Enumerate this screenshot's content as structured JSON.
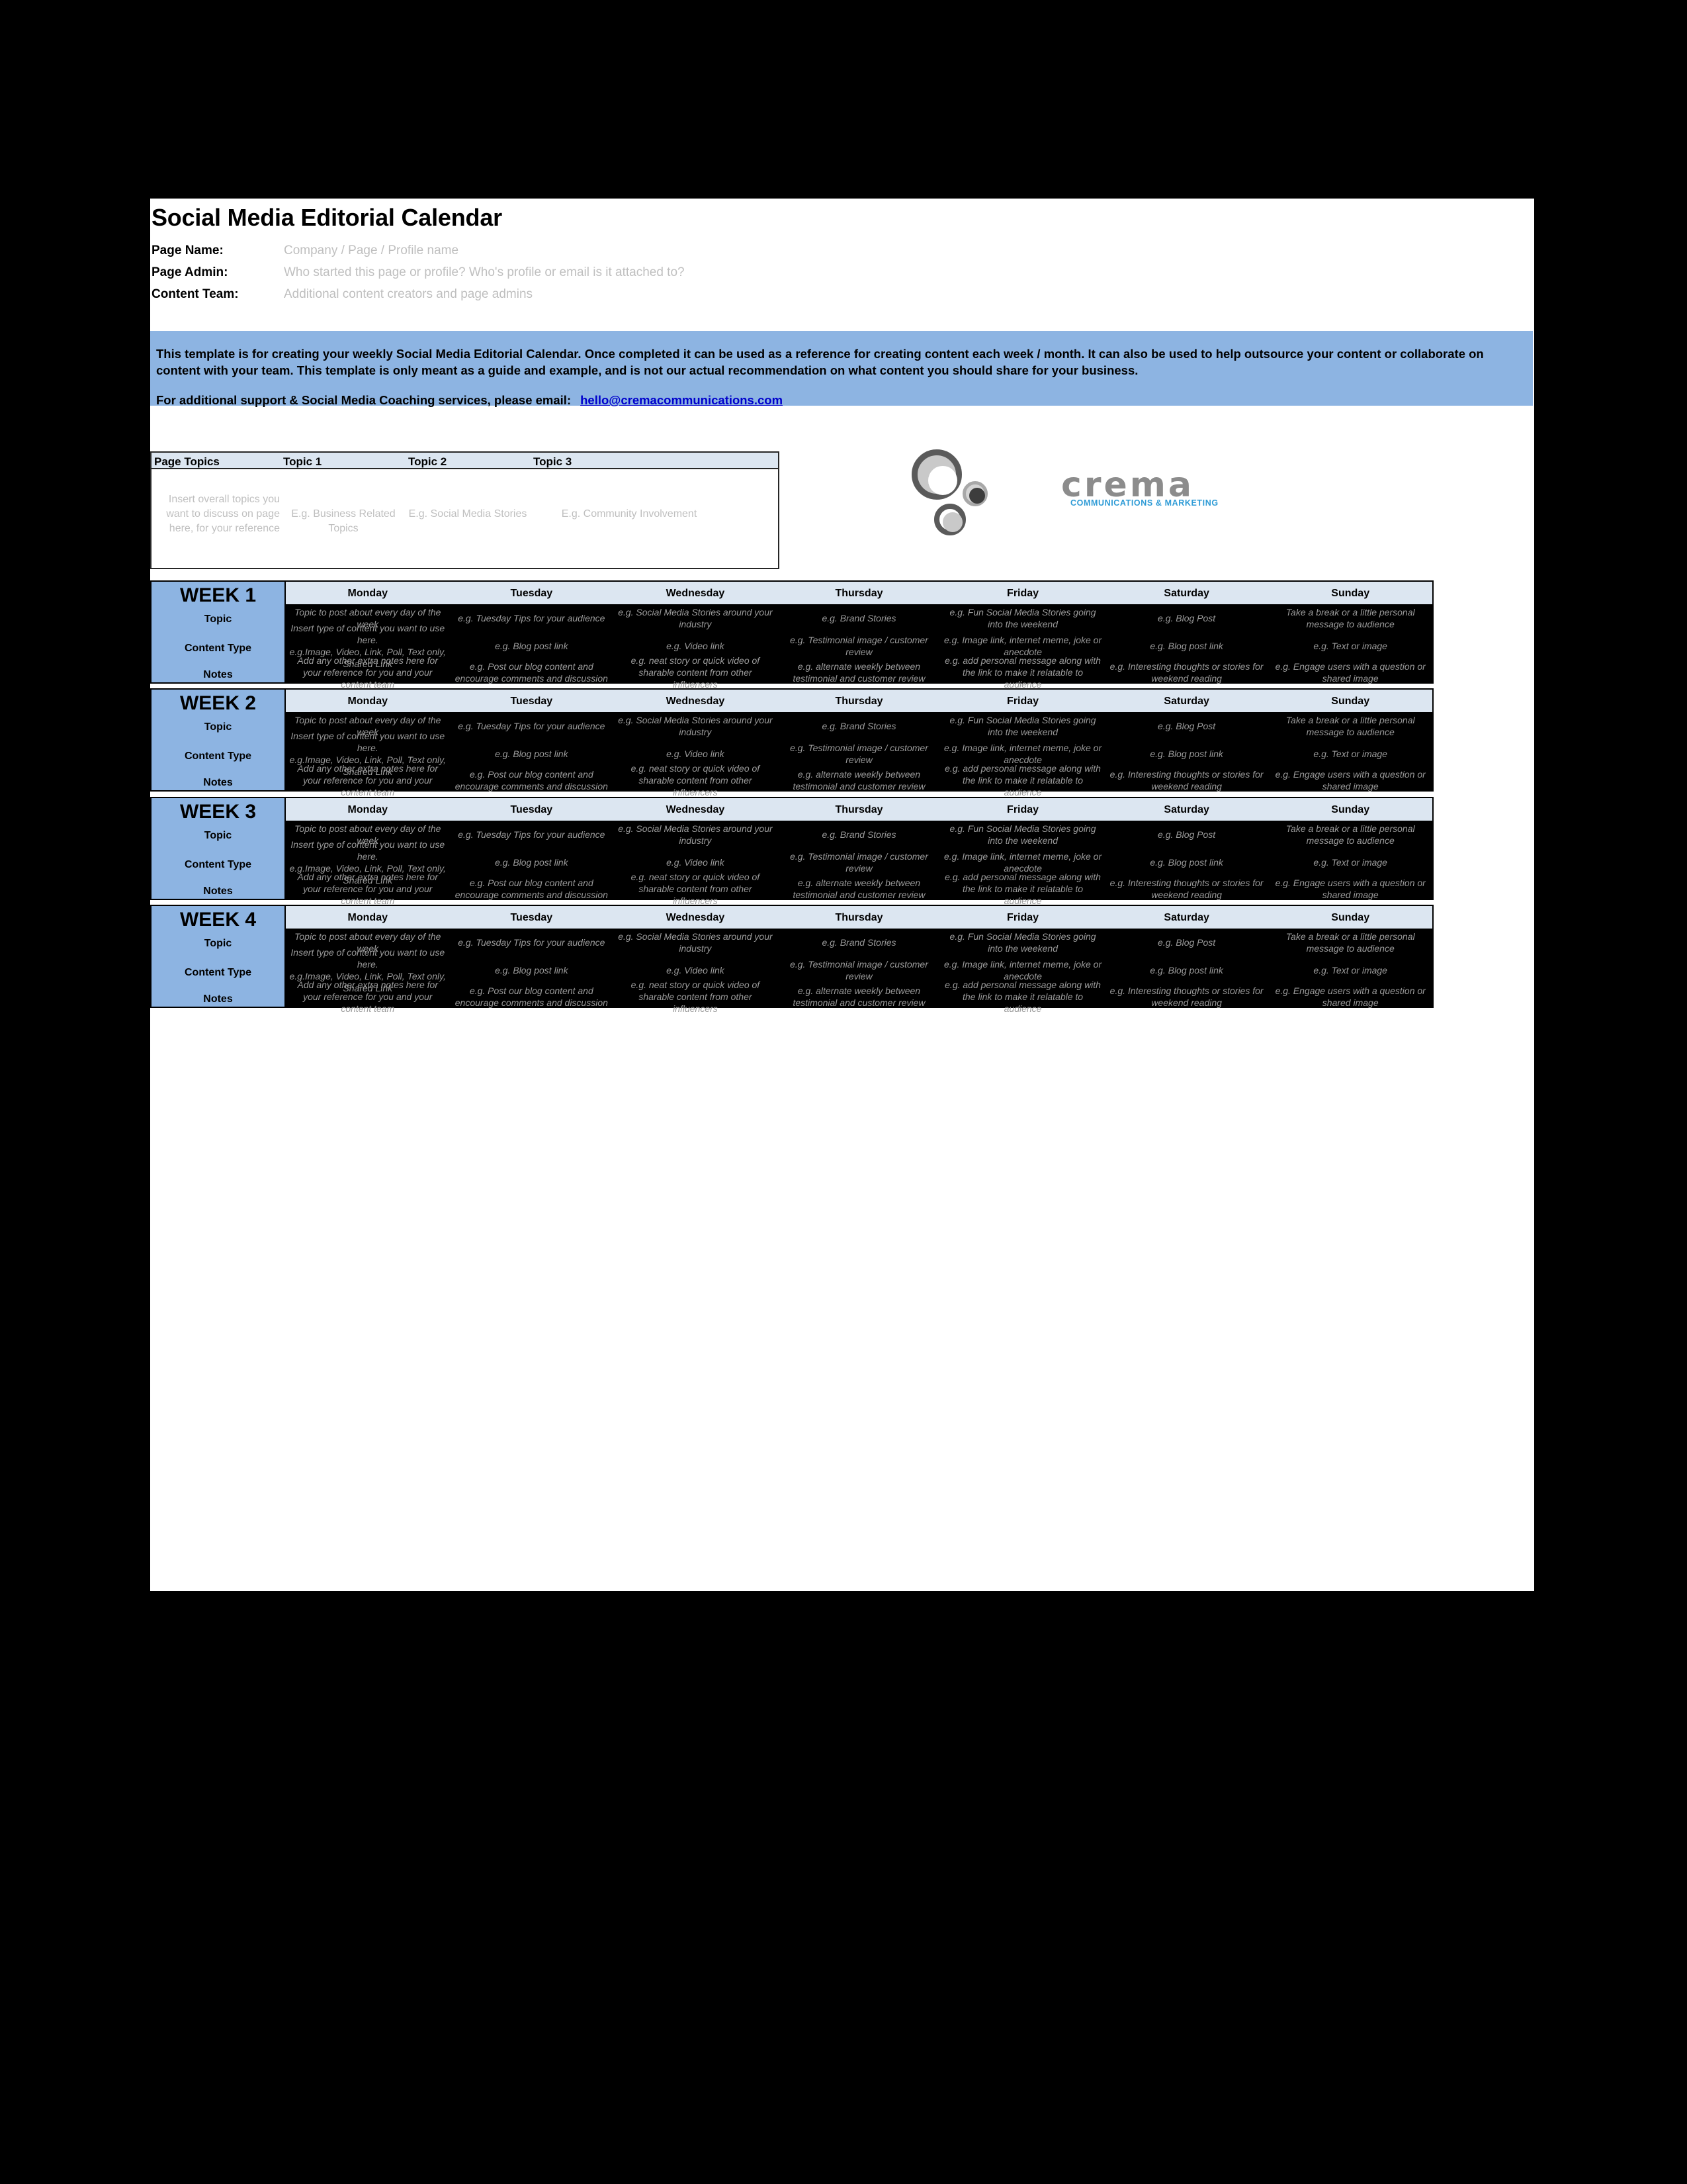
{
  "document": {
    "title": "Social Media Editorial Calendar"
  },
  "meta": [
    {
      "label": "Page Name:",
      "value": "Company / Page / Profile name"
    },
    {
      "label": "Page Admin:",
      "value": "Who started this page or profile? Who's profile or email is it attached to?"
    },
    {
      "label": "Content Team:",
      "value": "Additional content creators and page admins"
    }
  ],
  "callout": {
    "paragraph": "This template is for creating your weekly Social Media Editorial Calendar. Once completed it can be used as a reference for creating content each week / month. It can also be used to help outsource your content or collaborate on content with your team. This template is only meant as a guide and example, and is not our actual recommendation on what content you should share for your business.",
    "support_prefix": "For additional support & Social Media Coaching services, please email:",
    "email": "hello@cremacommunications.com",
    "bg_color": "#8DB4E2"
  },
  "topics_table": {
    "headers": [
      "Page Topics",
      "Topic 1",
      "Topic 2",
      "Topic 3"
    ],
    "cells": [
      "Insert overall topics you want to discuss on page here, for your reference",
      "E.g. Business Related Topics",
      "E.g. Social Media Stories",
      "E.g. Community Involvement"
    ],
    "header_bg": "#DCE6F1"
  },
  "logo": {
    "wordmark": "crema",
    "tagline": "COMMUNICATIONS & MARKETING",
    "tagline_color": "#2e9bd6",
    "wordmark_color": "#8c8c8c"
  },
  "calendar": {
    "row_labels": [
      "Topic",
      "Content Type",
      "Notes"
    ],
    "days": [
      "Monday",
      "Tuesday",
      "Wednesday",
      "Thursday",
      "Friday",
      "Saturday",
      "Sunday"
    ],
    "accent_color": "#8DB4E2",
    "dayband_color": "#DCE6F1",
    "cell_bg": "#000000",
    "cell_text_color": "#9a9a9a",
    "weeks": [
      {
        "name": "WEEK 1",
        "rows": {
          "topic": [
            "Topic to post about every day of the week",
            "e.g. Tuesday Tips for your audience",
            "e.g. Social Media Stories around your industry",
            "e.g. Brand Stories",
            "e.g. Fun Social Media Stories going into the weekend",
            "e.g. Blog Post",
            "Take a break or a little personal message to audience"
          ],
          "content_type": [
            "Insert type of content you want to use here.\ne.g.Image, Video, Link, Poll, Text only, Shared Link",
            "e.g. Blog post link",
            "e.g. Video link",
            "e.g. Testimonial image / customer review",
            "e.g. Image link, internet meme, joke or anecdote",
            "e.g. Blog post link",
            "e.g. Text or image"
          ],
          "notes": [
            "Add any other extra notes here for your reference for you and your content team",
            "e.g. Post our blog content and encourage comments and discussion",
            "e.g. neat story or quick video of sharable content from other influencers",
            "e.g. alternate weekly between testimonial and customer review",
            "e.g. add personal message along with the link to make it relatable to audience",
            "e.g. Interesting thoughts or stories for weekend reading",
            "e.g. Engage users with a question or shared image"
          ]
        }
      },
      {
        "name": "WEEK 2",
        "rows": {
          "topic": [
            "Topic to post about every day of the week",
            "e.g. Tuesday Tips for your audience",
            "e.g. Social Media Stories around your industry",
            "e.g. Brand Stories",
            "e.g. Fun Social Media Stories going into the weekend",
            "e.g. Blog Post",
            "Take a break or a little personal message to audience"
          ],
          "content_type": [
            "Insert type of content you want to use here.\ne.g.Image, Video, Link, Poll, Text only, Shared Link",
            "e.g. Blog post link",
            "e.g. Video link",
            "e.g. Testimonial image / customer review",
            "e.g. Image link, internet meme, joke or anecdote",
            "e.g. Blog post link",
            "e.g. Text or image"
          ],
          "notes": [
            "Add any other extra notes here for your reference for you and your content team",
            "e.g. Post our blog content and encourage comments and discussion",
            "e.g. neat story or quick video of sharable content from other influencers",
            "e.g. alternate weekly between testimonial and customer review",
            "e.g. add personal message along with the link to make it relatable to audience",
            "e.g. Interesting thoughts or stories for weekend reading",
            "e.g. Engage users with a question or shared image"
          ]
        }
      },
      {
        "name": "WEEK 3",
        "rows": {
          "topic": [
            "Topic to post about every day of the week",
            "e.g. Tuesday Tips for your audience",
            "e.g. Social Media Stories around your industry",
            "e.g. Brand Stories",
            "e.g. Fun Social Media Stories going into the weekend",
            "e.g. Blog Post",
            "Take a break or a little personal message to audience"
          ],
          "content_type": [
            "Insert type of content you want to use here.\ne.g.Image, Video, Link, Poll, Text only, Shared Link",
            "e.g. Blog post link",
            "e.g. Video link",
            "e.g. Testimonial image / customer review",
            "e.g. Image link, internet meme, joke or anecdote",
            "e.g. Blog post link",
            "e.g. Text or image"
          ],
          "notes": [
            "Add any other extra notes here for your reference for you and your content team",
            "e.g. Post our blog content and encourage comments and discussion",
            "e.g. neat story or quick video of sharable content from other influencers",
            "e.g. alternate weekly between testimonial and customer review",
            "e.g. add personal message along with the link to make it relatable to audience",
            "e.g. Interesting thoughts or stories for weekend reading",
            "e.g. Engage users with a question or shared image"
          ]
        }
      },
      {
        "name": "WEEK 4",
        "rows": {
          "topic": [
            "Topic to post about every day of the week",
            "e.g. Tuesday Tips for your audience",
            "e.g. Social Media Stories around your industry",
            "e.g. Brand Stories",
            "e.g. Fun Social Media Stories going into the weekend",
            "e.g. Blog Post",
            "Take a break or a little personal message to audience"
          ],
          "content_type": [
            "Insert type of content you want to use here.\ne.g.Image, Video, Link, Poll, Text only, Shared Link",
            "e.g. Blog post link",
            "e.g. Video link",
            "e.g. Testimonial image / customer review",
            "e.g. Image link, internet meme, joke or anecdote",
            "e.g. Blog post link",
            "e.g. Text or image"
          ],
          "notes": [
            "Add any other extra notes here for your reference for you and your content team",
            "e.g. Post our blog content and encourage comments and discussion",
            "e.g. neat story or quick video of sharable content from other influencers",
            "e.g. alternate weekly between testimonial and customer review",
            "e.g. add personal message along with the link to make it relatable to audience",
            "e.g. Interesting thoughts or stories for weekend reading",
            "e.g. Engage users with a question or shared image"
          ]
        }
      }
    ]
  }
}
